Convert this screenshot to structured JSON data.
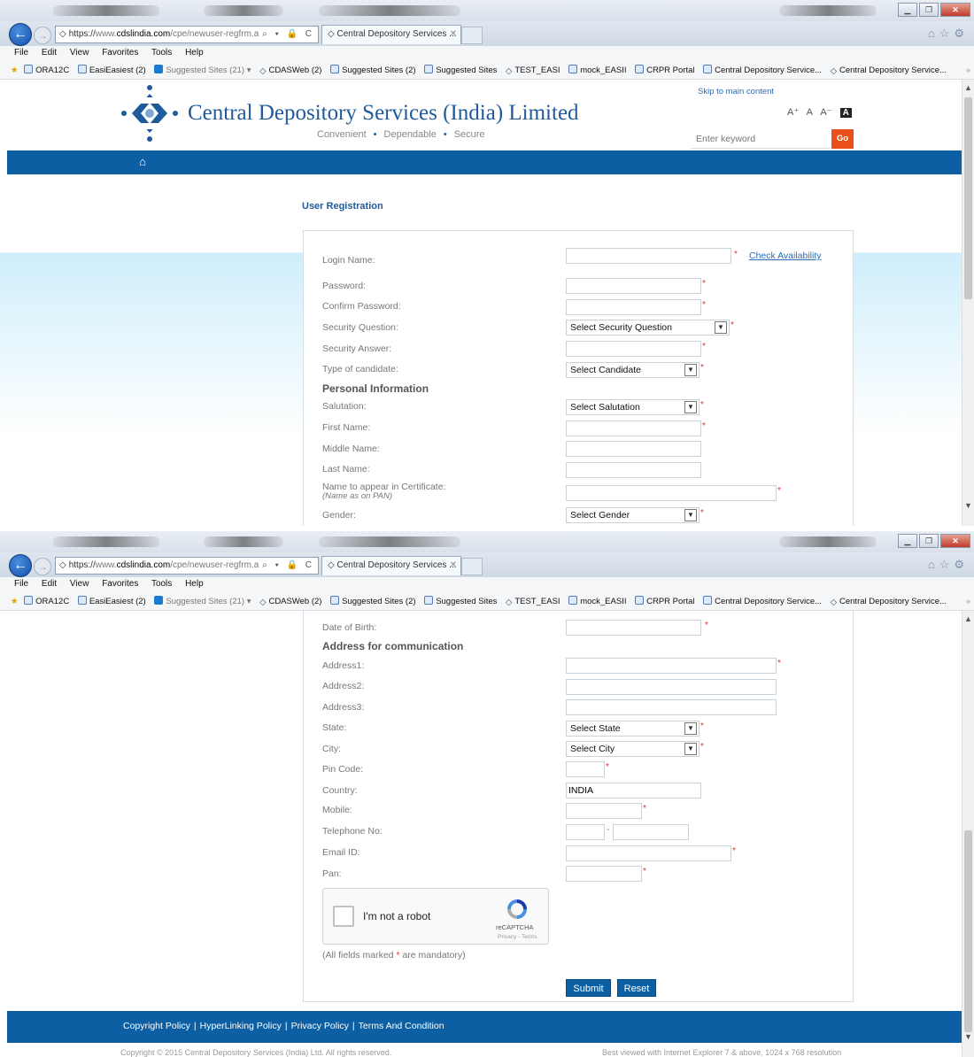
{
  "browser": {
    "address_scheme": "https://",
    "address_host_prefix": "www.",
    "address_host": "cdslindia.com",
    "address_path": "/cpe/newuser-regfrm.a",
    "address_controls": "⌕ ▾ 🔒 C",
    "tab_title": "Central Depository Services ...",
    "menu": [
      "File",
      "Edit",
      "View",
      "Favorites",
      "Tools",
      "Help"
    ],
    "favorites": [
      {
        "label": "ORA12C",
        "icon": "ie-page-icon"
      },
      {
        "label": "EasiEasiest (2)",
        "icon": "ie-page-icon"
      },
      {
        "label": "Suggested Sites (21) ▾",
        "icon": "bing-icon",
        "muted": true
      },
      {
        "label": "CDASWeb (2)",
        "icon": "cdsl-diamond-icon"
      },
      {
        "label": "Suggested Sites (2)",
        "icon": "ie-page-icon"
      },
      {
        "label": "Suggested Sites",
        "icon": "ie-page-icon"
      },
      {
        "label": "TEST_EASI",
        "icon": "cdsl-diamond-icon"
      },
      {
        "label": "mock_EASII",
        "icon": "ie-page-icon"
      },
      {
        "label": "CRPR Portal",
        "icon": "ie-page-icon"
      },
      {
        "label": "Central Depository Service...",
        "icon": "ie-page-icon"
      },
      {
        "label": "Central Depository Service...",
        "icon": "cdsl-diamond-icon"
      }
    ],
    "more_glyph": "»"
  },
  "header": {
    "site_name": "Central Depository Services (India) Limited",
    "tagline": [
      "Convenient",
      "Dependable",
      "Secure"
    ],
    "skip_link": "Skip to main content",
    "font_sizes": [
      "A⁺",
      "A",
      "A⁻",
      "A"
    ],
    "search_placeholder": "Enter keyword",
    "go_label": "Go"
  },
  "form": {
    "title": "User Registration",
    "check_availability": "Check Availability",
    "login_name": "Login Name:",
    "password": "Password:",
    "confirm_password": "Confirm Password:",
    "security_question": "Security Question:",
    "security_question_value": "Select Security Question",
    "security_answer": "Security Answer:",
    "candidate_type": "Type of candidate:",
    "candidate_type_value": "Select Candidate",
    "personal_section": "Personal Information",
    "salutation": "Salutation:",
    "salutation_value": "Select Salutation",
    "first_name": "First Name:",
    "middle_name": "Middle Name:",
    "last_name": "Last Name:",
    "cert_name": "Name to appear in Certificate:",
    "cert_name_hint": "(Name as on PAN)",
    "gender": "Gender:",
    "gender_value": "Select Gender",
    "dob": "Date of Birth:",
    "address_section": "Address for communication",
    "address1": "Address1:",
    "address2": "Address2:",
    "address3": "Address3:",
    "state": "State:",
    "state_value": "Select State",
    "city": "City:",
    "city_value": "Select City",
    "pin": "Pin Code:",
    "country": "Country:",
    "country_value": "INDIA",
    "mobile": "Mobile:",
    "telephone": "Telephone No:",
    "email": "Email ID:",
    "pan": "Pan:",
    "captcha_text": "I'm not a robot",
    "captcha_brand": "reCAPTCHA",
    "captcha_terms": "Privacy - Terms",
    "mandatory_note_prefix": "(All fields marked ",
    "mandatory_note_star": "*",
    "mandatory_note_suffix": " are mandatory)",
    "submit": "Submit",
    "reset": "Reset"
  },
  "footer": {
    "links": [
      "Copyright Policy",
      "HyperLinking Policy",
      "Privacy Policy",
      "Terms And Condition"
    ],
    "separator": "|",
    "copyright": "Copyright © 2015 Central Depository Services (India) Ltd. All rights reserved.",
    "best_view": "Best viewed with Internet Explorer 7 & above, 1024 x 768 resolution"
  },
  "colors": {
    "brand_blue": "#0d5fa3",
    "title_blue": "#1f5a9c",
    "go_orange": "#e94e1b",
    "required_red": "#e2342a"
  }
}
